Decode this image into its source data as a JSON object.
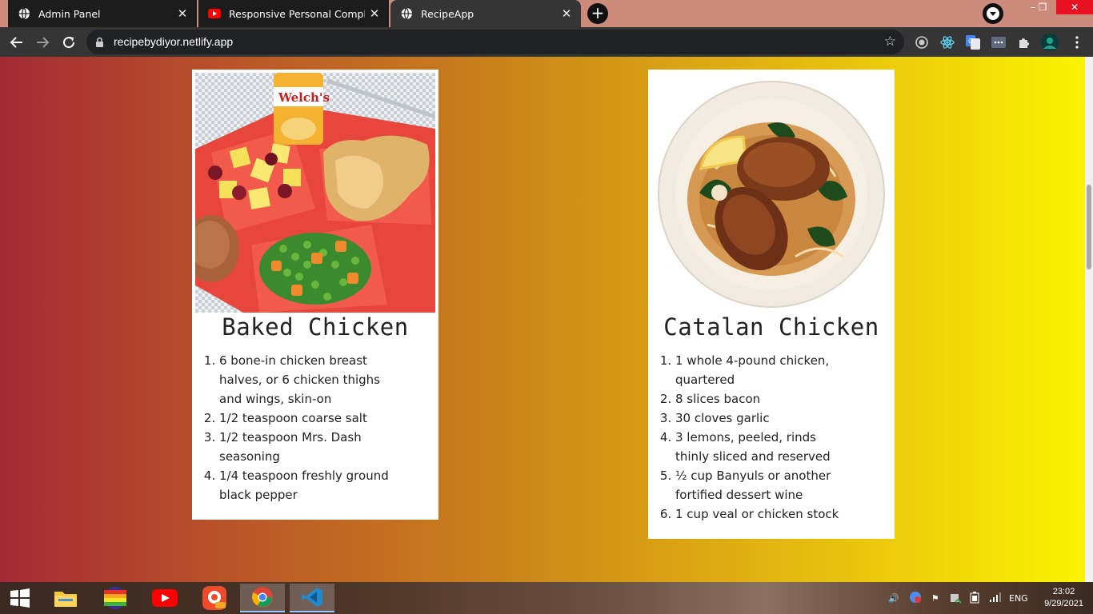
{
  "browser": {
    "tabs": [
      {
        "title": "Admin Panel",
        "close": "✕",
        "favicon": "globe-icon"
      },
      {
        "title": "Responsive Personal Complete Po",
        "close": "✕",
        "favicon": "youtube-icon"
      },
      {
        "title": "RecipeApp",
        "close": "✕",
        "favicon": "globe-icon"
      }
    ],
    "new_tab": "+",
    "address": "recipebydiyor.netlify.app",
    "window_controls": {
      "minimize": "–",
      "restore": "❐",
      "close": "✕"
    },
    "accent": "#e81123"
  },
  "recipes": [
    {
      "title": "Baked Chicken",
      "ingredients": [
        "6 bone-in chicken breast halves, or 6 chicken thighs and wings, skin-on",
        "1/2 teaspoon coarse salt",
        "1/2 teaspoon Mrs. Dash seasoning",
        "1/4 teaspoon freshly ground black pepper"
      ],
      "photo_label": "Welch's"
    },
    {
      "title": "Catalan Chicken",
      "ingredients": [
        "1 whole 4-pound chicken, quartered",
        "8 slices bacon",
        "30 cloves garlic",
        "3 lemons, peeled, rinds thinly sliced and reserved",
        "½ cup Banyuls or another fortified dessert wine",
        "1 cup veal or chicken stock"
      ]
    }
  ],
  "taskbar": {
    "language": "ENG",
    "time": "23:02",
    "date": "9/29/2021"
  }
}
